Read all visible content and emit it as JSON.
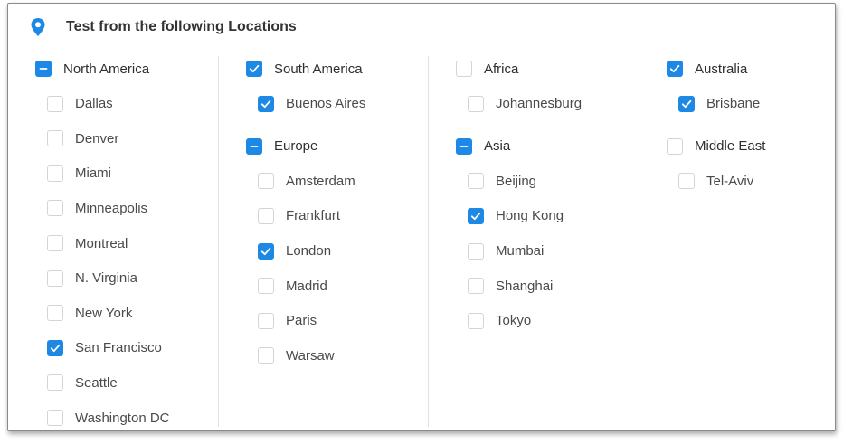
{
  "header": {
    "title": "Test from the following Locations",
    "icon": "location-pin-icon"
  },
  "colors": {
    "accent": "#1e88e5"
  },
  "columns": [
    {
      "groups": [
        {
          "label": "North America",
          "state": "partial",
          "cities": [
            {
              "label": "Dallas",
              "checked": false
            },
            {
              "label": "Denver",
              "checked": false
            },
            {
              "label": "Miami",
              "checked": false
            },
            {
              "label": "Minneapolis",
              "checked": false
            },
            {
              "label": "Montreal",
              "checked": false
            },
            {
              "label": "N. Virginia",
              "checked": false
            },
            {
              "label": "New York",
              "checked": false
            },
            {
              "label": "San Francisco",
              "checked": true
            },
            {
              "label": "Seattle",
              "checked": false
            },
            {
              "label": "Washington DC",
              "checked": false
            }
          ]
        }
      ]
    },
    {
      "groups": [
        {
          "label": "South America",
          "state": "checked",
          "cities": [
            {
              "label": "Buenos Aires",
              "checked": true
            }
          ]
        },
        {
          "label": "Europe",
          "state": "partial",
          "cities": [
            {
              "label": "Amsterdam",
              "checked": false
            },
            {
              "label": "Frankfurt",
              "checked": false
            },
            {
              "label": "London",
              "checked": true
            },
            {
              "label": "Madrid",
              "checked": false
            },
            {
              "label": "Paris",
              "checked": false
            },
            {
              "label": "Warsaw",
              "checked": false
            }
          ]
        }
      ]
    },
    {
      "groups": [
        {
          "label": "Africa",
          "state": "unchecked",
          "cities": [
            {
              "label": "Johannesburg",
              "checked": false
            }
          ]
        },
        {
          "label": "Asia",
          "state": "partial",
          "cities": [
            {
              "label": "Beijing",
              "checked": false
            },
            {
              "label": "Hong Kong",
              "checked": true
            },
            {
              "label": "Mumbai",
              "checked": false
            },
            {
              "label": "Shanghai",
              "checked": false
            },
            {
              "label": "Tokyo",
              "checked": false
            }
          ]
        }
      ]
    },
    {
      "groups": [
        {
          "label": "Australia",
          "state": "checked",
          "cities": [
            {
              "label": "Brisbane",
              "checked": true
            }
          ]
        },
        {
          "label": "Middle East",
          "state": "unchecked",
          "cities": [
            {
              "label": "Tel-Aviv",
              "checked": false
            }
          ]
        }
      ]
    }
  ]
}
